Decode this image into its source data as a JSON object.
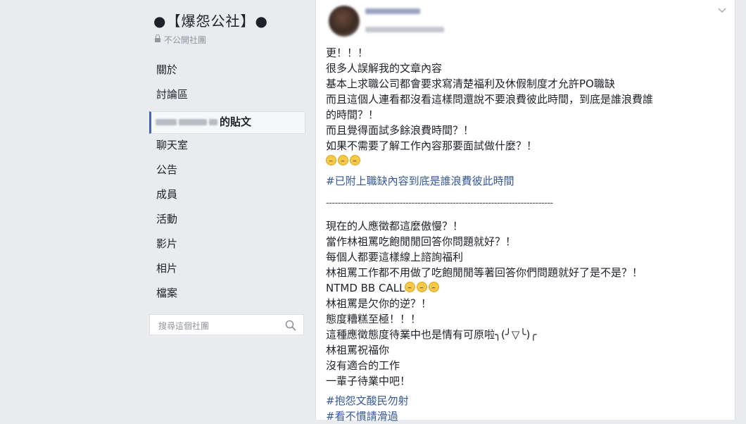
{
  "sidebar": {
    "group_title": "●【爆怨公社】●",
    "privacy": "不公開社團",
    "items": [
      {
        "label": "關於"
      },
      {
        "label": "討論區"
      },
      {
        "label": "的貼文"
      },
      {
        "label": "聊天室"
      },
      {
        "label": "公告"
      },
      {
        "label": "成員"
      },
      {
        "label": "活動"
      },
      {
        "label": "影片"
      },
      {
        "label": "相片"
      },
      {
        "label": "檔案"
      }
    ],
    "active_index": 2,
    "search_placeholder": "搜尋這個社團"
  },
  "post": {
    "text_lines": [
      "更！！！",
      "很多人誤解我的文章內容",
      "基本上求職公司都會要求寫清楚福利及休假制度才允許PO職缺",
      "而且這個人連看都沒看這樣問還說不要浪費彼此時間，到底是誰浪費誰",
      "的時間？！",
      "而且覺得面試多餘浪費時間？！",
      "如果不需要了解工作內容那要面試做什麼？！"
    ],
    "hashtag_1": "#已附上職缺內容到底是誰浪費彼此時間",
    "divider": "-----------------------------------------------------------------------------",
    "text_lines_2": [
      "現在的人應徵都這麼傲慢？！",
      "當作林祖罵吃飽閒閒回答你問題就好？！",
      "每個人都要這樣線上諮詢福利",
      "林祖罵工作都不用做了吃飽閒閒等著回答你們問題就好了是不是？！"
    ],
    "ntmd": "NTMD BB CALL",
    "text_lines_3": [
      "林祖罵是欠你的逆？！",
      "態度糟糕至極！！！",
      "這種應徵態度待業中也是情有可原啦╮(╯▽╰)╭",
      "林祖罵祝福你",
      "沒有適合的工作",
      "一輩子待業中吧！"
    ],
    "hashtags_end": [
      "#抱怨文酸民勿射",
      "#看不慣請滑過"
    ]
  },
  "colors": {
    "background": "#e9ebee",
    "hashtag": "#365899",
    "active_accent": "#4267b2"
  }
}
